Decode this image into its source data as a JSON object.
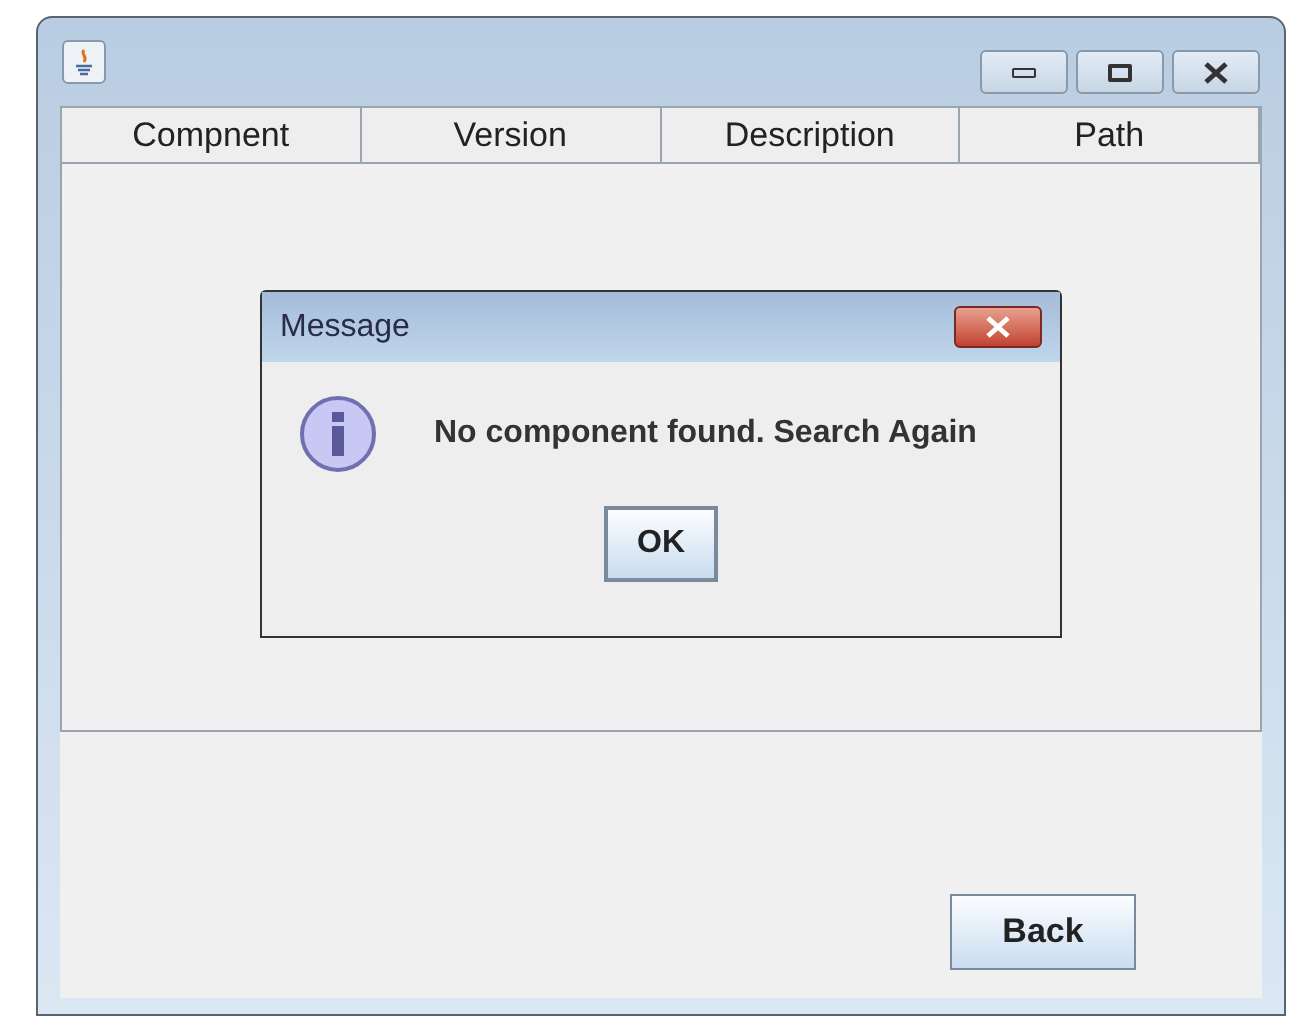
{
  "table": {
    "columns": [
      "Compnent",
      "Version",
      "Description",
      "Path"
    ]
  },
  "dialog": {
    "title": "Message",
    "message": "No component found. Search Again",
    "buttons": [
      "OK"
    ]
  },
  "buttons": [
    "Back"
  ]
}
